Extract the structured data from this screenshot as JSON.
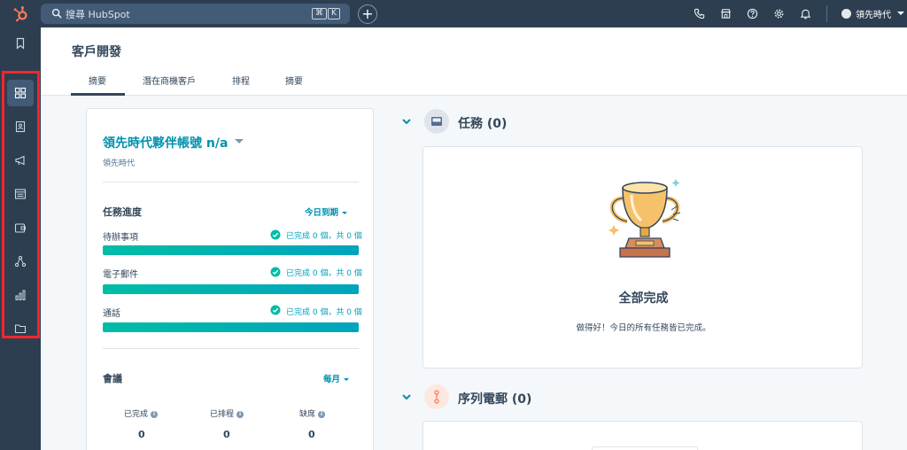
{
  "topbar": {
    "search_placeholder": "搜尋 HubSpot",
    "kbd_cmd": "⌘",
    "kbd_k": "K",
    "plus": "+",
    "user_name": "領先時代"
  },
  "header": {
    "title": "客戶開發",
    "tabs": [
      "摘要",
      "潛在商機客戶",
      "排程",
      "摘要"
    ]
  },
  "account": {
    "name": "領先時代夥伴帳號 n/a",
    "subtitle": "領先時代"
  },
  "task_progress": {
    "title": "任務進度",
    "filter": "今日到期",
    "items": [
      {
        "label": "待辦事項",
        "status": "已完成 0 個，共 0 個",
        "progress": 1.0
      },
      {
        "label": "電子郵件",
        "status": "已完成 0 個，共 0 個",
        "progress": 1.0
      },
      {
        "label": "通話",
        "status": "已完成 0 個，共 0 個",
        "progress": 1.0
      }
    ]
  },
  "meetings": {
    "title": "會議",
    "filter": "每月",
    "stats": [
      {
        "label": "已完成",
        "value": "0"
      },
      {
        "label": "已排程",
        "value": "0"
      },
      {
        "label": "缺席",
        "value": "0"
      }
    ]
  },
  "tasks_section": {
    "title": "任務 (0)",
    "done_title": "全部完成",
    "done_subtitle": "做得好！今日的所有任務皆已完成。"
  },
  "sequences_section": {
    "title": "序列電郵 (0)"
  },
  "colors": {
    "nav_bg": "#2d3e50",
    "accent_teal": "#0091ae",
    "bar_green": "#00bda5",
    "highlight_red": "#f2262f",
    "logo_orange": "#ff7a59"
  }
}
